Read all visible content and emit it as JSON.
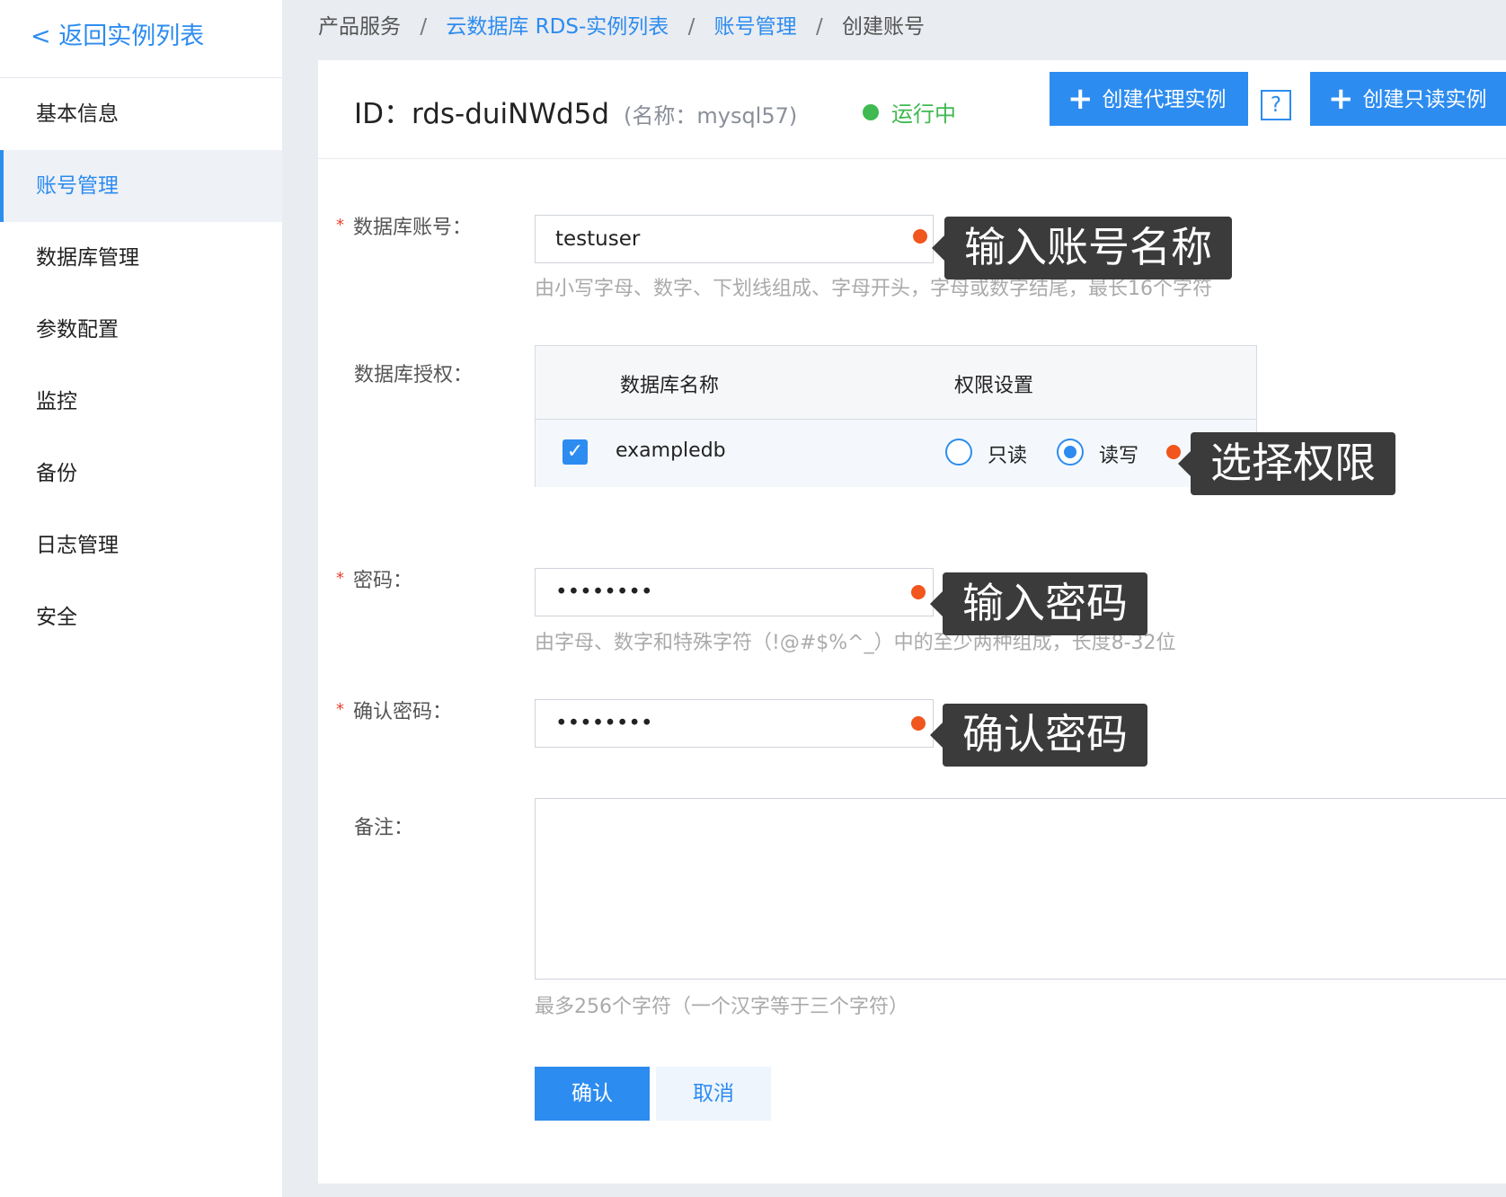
{
  "sidebar": {
    "back_link": "< 返回实例列表",
    "items": [
      {
        "label": "基本信息"
      },
      {
        "label": "账号管理",
        "active": true
      },
      {
        "label": "数据库管理"
      },
      {
        "label": "参数配置"
      },
      {
        "label": "监控"
      },
      {
        "label": "备份"
      },
      {
        "label": "日志管理"
      },
      {
        "label": "安全"
      }
    ]
  },
  "breadcrumb": {
    "items": [
      "产品服务",
      "云数据库 RDS-实例列表",
      "账号管理",
      "创建账号"
    ],
    "separator": "/"
  },
  "header": {
    "instance_id": "ID：rds-duiNWd5d",
    "instance_name": "(名称：mysql57)",
    "status": "运行中",
    "status_color": "#3fb950",
    "create_proxy_button": "创建代理实例",
    "help_button": "?",
    "create_readonly_button": "创建只读实例"
  },
  "form": {
    "account": {
      "label": "数据库账号：",
      "required_mark": "*",
      "value": "testuser",
      "hint": "由小写字母、数字、下划线组成、字母开头，字母或数字结尾，最长16个字符",
      "callout": "输入账号名称"
    },
    "authorization": {
      "label": "数据库授权：",
      "columns": [
        "数据库名称",
        "权限设置"
      ],
      "rows": [
        {
          "checked": true,
          "db_name": "exampledb",
          "options": [
            "只读",
            "读写"
          ],
          "selected": "读写"
        }
      ],
      "callout": "选择权限"
    },
    "password": {
      "label": "密码：",
      "required_mark": "*",
      "value": "••••••••",
      "hint": "由字母、数字和特殊字符（!@#$%^_）中的至少两种组成，长度8-32位",
      "callout": "输入密码"
    },
    "confirm_password": {
      "label": "确认密码：",
      "required_mark": "*",
      "value": "••••••••",
      "callout": "确认密码"
    },
    "remark": {
      "label": "备注：",
      "value": "",
      "hint": "最多256个字符（一个汉字等于三个字符）"
    },
    "confirm_button": "确认",
    "cancel_button": "取消"
  },
  "colors": {
    "accent": "#2d8cf0",
    "marker": "#f0561d",
    "callout_bg": "#3b3b3b"
  }
}
